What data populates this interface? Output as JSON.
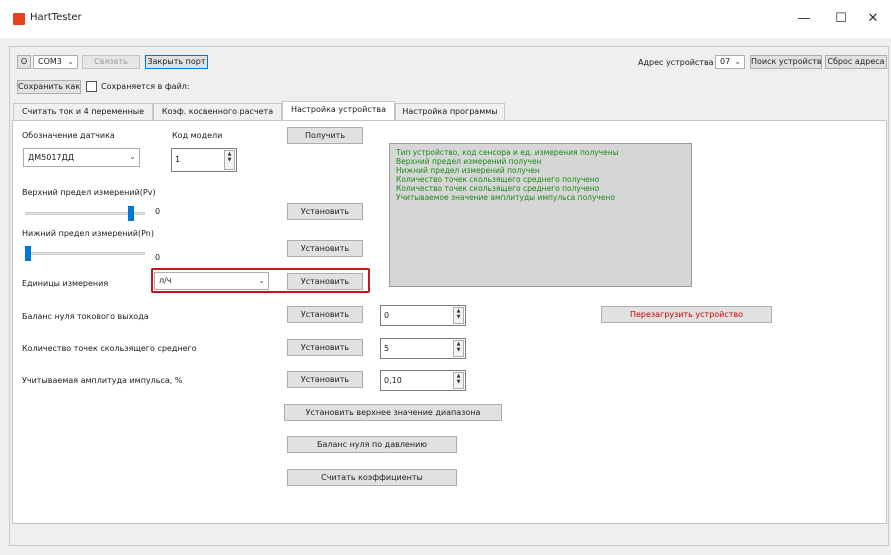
{
  "window": {
    "title": "HartTester",
    "minimize": "—",
    "maximize": "☐",
    "close": "✕"
  },
  "colors": {
    "log_text": "#1b8a1b",
    "reboot_text": "#cc0000",
    "highlight": "#c4161c",
    "accent": "#0078d7"
  },
  "toolbar": {
    "port_label": "О",
    "port_value": "COM3",
    "connect_label": "Связать",
    "close_port_label": "Закрыть порт",
    "address_label": "Адрес устройства",
    "address_value": "07",
    "search_label": "Поиск устройств",
    "reset_address_label": "Сброс адреса",
    "save_as_label": "Сохранить как",
    "save_checkbox_label": "Сохраняется в файл:"
  },
  "tabs": [
    {
      "label": "Считать ток и 4 переменные"
    },
    {
      "label": "Коэф. косвенного расчета"
    },
    {
      "label": "Настройка устройства"
    },
    {
      "label": "Настройка программы"
    }
  ],
  "form": {
    "sensor_label": "Обозначение датчика",
    "sensor_value": "ДМ5017ДД",
    "model_label": "Код модели",
    "model_value": "1",
    "get_label": "Получить",
    "upper_label": "Верхний предел измерений(Pv)",
    "upper_value": "0",
    "upper_level": 0.9,
    "lower_label": "Нижний предел измерений(Pn)",
    "lower_value": "0",
    "lower_level": 0.0,
    "set_label": "Установить",
    "units_label": "Единицы измерения",
    "units_value": "л/ч",
    "balance_label": "Баланс нуля токового выхода",
    "balance_value": "0",
    "points_label": "Количество точек скользящего среднего",
    "points_value": "5",
    "amplitude_label": "Учитываемая амплитуда импульса, %",
    "amplitude_value": "0,10",
    "set_upper_range_label": "Установить верхнее значение диапазона",
    "pressure_zero_label": "Баланс нуля по давлению",
    "read_coef_label": "Считать коэффициенты",
    "reboot_label": "Перезагрузить устройство"
  },
  "log": [
    "Тип устройство, код сенсора и ед. измерения получены",
    "Верхний предел измерений получен",
    "Нижний предел измерений получен",
    "Количество точек скользящего среднего получено",
    "Количество точек скользящего среднего получено",
    "Учитываемое значение амплитуды импульса получено"
  ]
}
